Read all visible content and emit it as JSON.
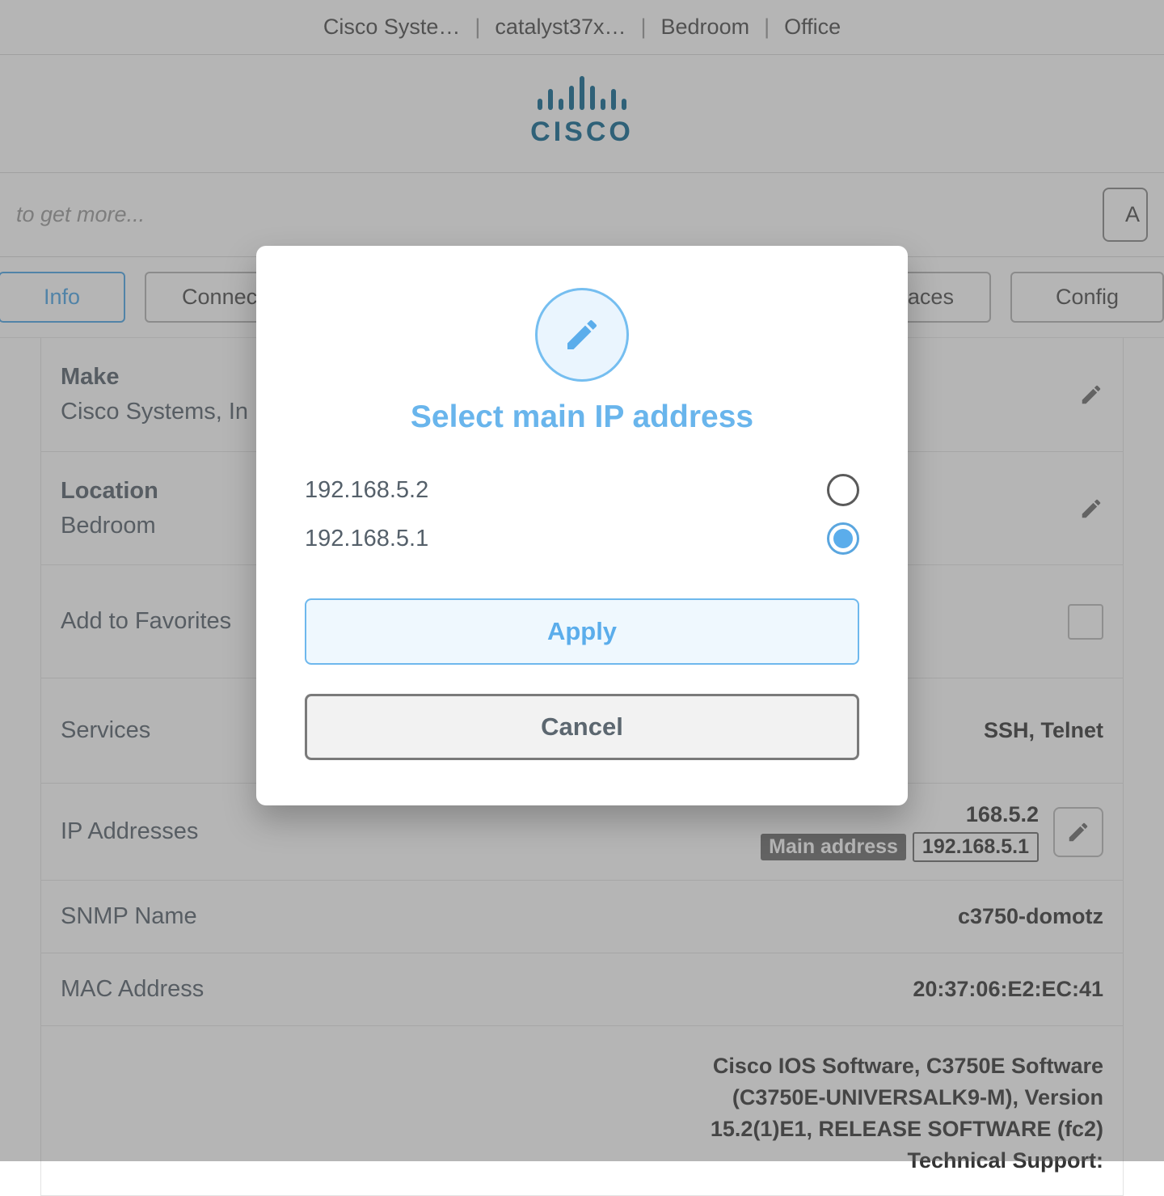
{
  "breadcrumb": {
    "item0": "Cisco Syste…",
    "item1": "catalyst37x…",
    "item2": "Bedroom",
    "item3": "Office"
  },
  "logo": {
    "text": "CISCO"
  },
  "search": {
    "placeholder": "to get more...",
    "button_cut": "A"
  },
  "tabs": {
    "info": "Info",
    "connect": "Connec",
    "interfaces": "terfaces",
    "config": "Config"
  },
  "info": {
    "make_label": "Make",
    "make_value": "Cisco Systems, In",
    "location_label": "Location",
    "location_value": "Bedroom",
    "favorites_label": "Add to Favorites",
    "services_label": "Services",
    "services_value": "SSH, Telnet",
    "ip_label": "IP Addresses",
    "ip_value1": "168.5.2",
    "main_addr_label": "Main address",
    "ip_value2": "192.168.5.1",
    "snmp_label": "SNMP Name",
    "snmp_value": "c3750-domotz",
    "mac_label": "MAC Address",
    "mac_value": "20:37:06:E2:EC:41",
    "sw_banner": "Cisco IOS Software, C3750E Software (C3750E-UNIVERSALK9-M), Version 15.2(1)E1, RELEASE SOFTWARE (fc2) Technical Support:"
  },
  "modal": {
    "title": "Select main IP address",
    "option0": "192.168.5.2",
    "option1": "192.168.5.1",
    "apply": "Apply",
    "cancel": "Cancel"
  }
}
